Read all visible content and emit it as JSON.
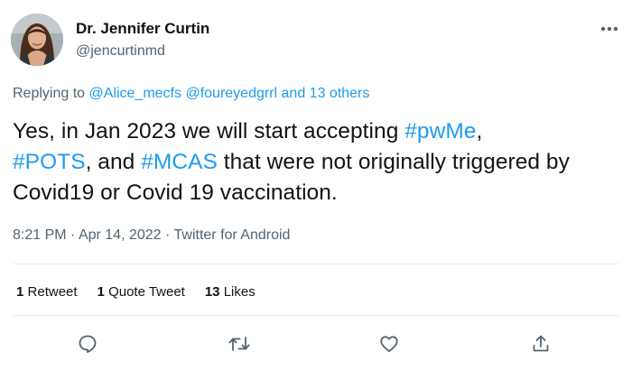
{
  "author": {
    "name": "Dr. Jennifer Curtin",
    "handle": "@jencurtinmd",
    "avatar_icon": "profile-photo"
  },
  "reply_to": {
    "prefix": "Replying to",
    "mention_1": "@Alice_mecfs",
    "mention_2": "@foureyedgrrl",
    "and_text": "and 13 others"
  },
  "tweet": {
    "text_1": "Yes, in Jan 2023 we will start accepting ",
    "hashtag_1": "#pwMe",
    "text_2": ",",
    "hashtag_2": "#POTS",
    "text_3": ", and ",
    "hashtag_3": "#MCAS",
    "text_4": " that were not originally triggered by Covid19 or Covid 19 vaccination."
  },
  "meta": {
    "time": "8:21 PM",
    "date": "Apr 14, 2022",
    "source": "Twitter for Android",
    "separator": " · "
  },
  "stats": {
    "retweets_count": "1",
    "retweets_label": "Retweet",
    "quotes_count": "1",
    "quotes_label": "Quote Tweet",
    "likes_count": "13",
    "likes_label": "Likes"
  },
  "actions": [
    "reply-icon",
    "retweet-icon",
    "like-icon",
    "share-icon"
  ],
  "colors": {
    "link": "#1d9bf0",
    "text": "#0f1419",
    "secondary": "#536471",
    "divider": "#e6ecf0"
  }
}
